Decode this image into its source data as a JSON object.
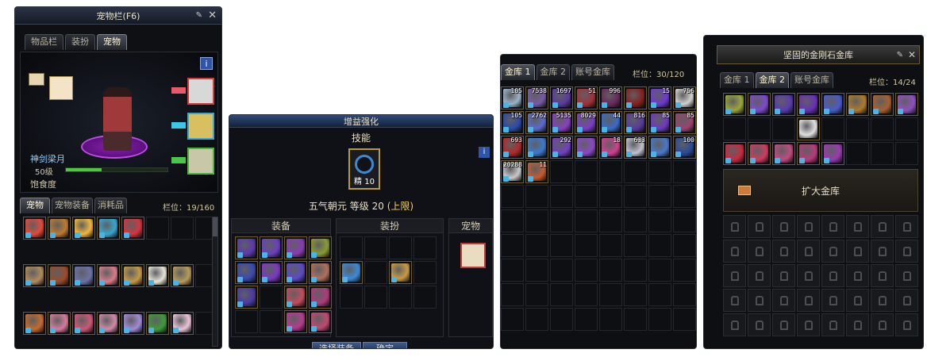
{
  "panel1": {
    "title": "宠物栏(F6)",
    "tabs": [
      "物品栏",
      "装扮",
      "宠物"
    ],
    "active_tab": 2,
    "pet_name": "神剑梁月",
    "level_label": "50级",
    "hunger_label": "饱食度",
    "sub_tabs": [
      "宠物",
      "宠物装备",
      "消耗品"
    ],
    "slot_label": "栏位：19/160",
    "info_button": "i",
    "pet_grid_rows": [
      [
        "#e24a3a",
        "#c07a2c",
        "#f2b63a",
        "#37a6cf",
        "#d5353e",
        "",
        "",
        "",
        ""
      ],
      [
        "#b28b5a",
        "#9b4a2a",
        "#6c72a8",
        "#d87b8a",
        "#c59a45",
        "#e7e2d6",
        "#b89a5a",
        "",
        ""
      ],
      [
        "#c46a2e",
        "#d67a9a",
        "#cf5775",
        "#cf8aa5",
        "#a18ad6",
        "#3f9a3a",
        "#e9c4d8",
        "",
        ""
      ]
    ],
    "badge_text": "搭配"
  },
  "panel2": {
    "title": "增益强化",
    "section_label": "技能",
    "skill_grade": "精 10",
    "skill_name": "五气朝元",
    "level_text": "等级 20",
    "limit_text": "(上限)",
    "columns": [
      "装备",
      "装扮",
      "宠物"
    ],
    "buttons": [
      "选择装备",
      "确定"
    ]
  },
  "panel3": {
    "tabs": [
      "金库 1",
      "金库 2",
      "账号金库"
    ],
    "active_tab": 0,
    "slot_label": "栏位：30/120",
    "rows": [
      [
        {
          "n": "105",
          "c": "#9ab3c7"
        },
        {
          "n": "7538",
          "c": "#7a58a8"
        },
        {
          "n": "1697",
          "c": "#5b3aa0"
        },
        {
          "n": "51",
          "c": "#a4303a"
        },
        {
          "n": "996",
          "c": "#6a2a5a"
        },
        {
          "n": "",
          "c": "#8a2020"
        },
        {
          "n": "15",
          "c": "#6e3ad0"
        },
        {
          "n": "756",
          "c": "#d0d0d0"
        }
      ],
      [
        {
          "n": "105",
          "c": "#2c4aa8"
        },
        {
          "n": "2762",
          "c": "#5a6ad0"
        },
        {
          "n": "5135",
          "c": "#8a3fc0"
        },
        {
          "n": "8029",
          "c": "#7a3cc8"
        },
        {
          "n": "44",
          "c": "#3a6ac8"
        },
        {
          "n": "816",
          "c": "#5a3aa0"
        },
        {
          "n": "85",
          "c": "#6e3ac0"
        },
        {
          "n": "85",
          "c": "#a04070"
        }
      ],
      [
        {
          "n": "693",
          "c": "#b02a2a"
        },
        {
          "n": "",
          "c": "#3a7ad0"
        },
        {
          "n": "292",
          "c": "#7040c0"
        },
        {
          "n": "",
          "c": "#8a48c8"
        },
        {
          "n": "18",
          "c": "#d04090"
        },
        {
          "n": "633",
          "c": "#c0c0d0"
        },
        {
          "n": "",
          "c": "#4a78c8"
        },
        {
          "n": "100",
          "c": "#2a4a9a"
        }
      ],
      [
        {
          "n": "20288",
          "c": "#c8c8c8"
        },
        {
          "n": "11",
          "c": "#c85a30"
        }
      ]
    ]
  },
  "panel4": {
    "title": "坚固的金刚石金库",
    "tabs": [
      "金库 1",
      "金库 2",
      "账号金库"
    ],
    "active_tab": 1,
    "slot_label": "栏位：14/24",
    "expand_label": "扩大金库",
    "row1": [
      "#9aa63a",
      "#7c4ad0",
      "#5a3ab0",
      "#6a30b8",
      "#4a5ac8",
      "#b07a2a",
      "#a86030",
      "#9050c0"
    ],
    "row3": [
      "#c82a40",
      "#d03a60",
      "#c04a80",
      "#b83a7a",
      "#9a3ab0"
    ],
    "pet_icon_color": "#e0e0e0"
  }
}
